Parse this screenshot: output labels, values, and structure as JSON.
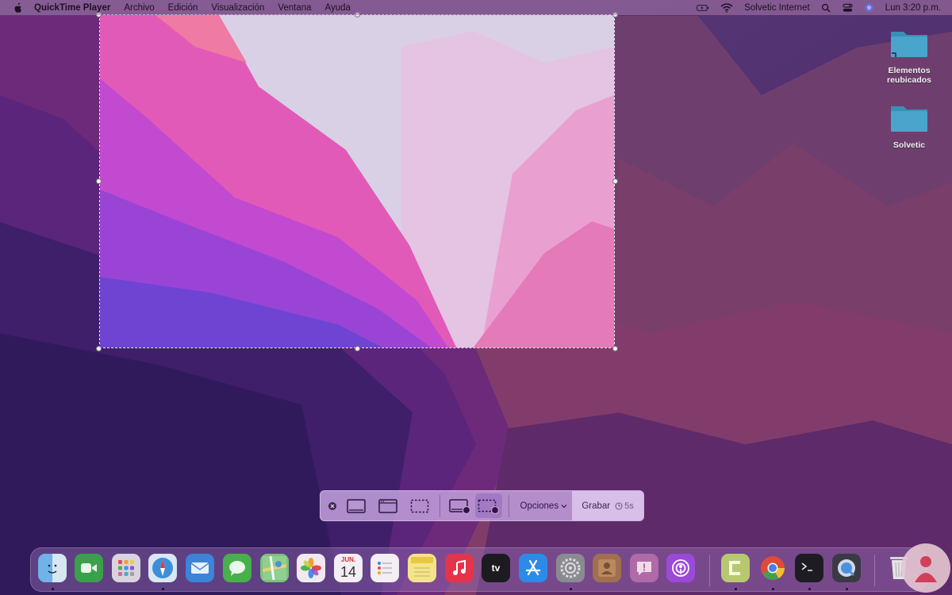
{
  "menubar": {
    "app_name": "QuickTime Player",
    "menus": [
      "Archivo",
      "Edición",
      "Visualización",
      "Ventana",
      "Ayuda"
    ],
    "wifi_name": "Solvetic Internet",
    "clock": "Lun 3:20 p.m."
  },
  "desktop": {
    "items": [
      {
        "label": "Elementos reubicados",
        "icon": "folder-alias-icon"
      },
      {
        "label": "Solvetic",
        "icon": "folder-icon"
      }
    ]
  },
  "screenshot_toolbar": {
    "options_label": "Opciones",
    "record_label": "Grabar",
    "timer_label": "5s",
    "mode_selected": "record-selected-portion"
  },
  "dock": {
    "apps": [
      {
        "name": "finder-icon",
        "running": true
      },
      {
        "name": "facetime-icon",
        "running": false
      },
      {
        "name": "launchpad-icon",
        "running": false
      },
      {
        "name": "safari-icon",
        "running": true
      },
      {
        "name": "mail-icon",
        "running": false
      },
      {
        "name": "messages-icon",
        "running": false
      },
      {
        "name": "maps-icon",
        "running": false
      },
      {
        "name": "photos-icon",
        "running": false
      },
      {
        "name": "calendar-icon",
        "running": false,
        "month": "JUN.",
        "day": "14"
      },
      {
        "name": "reminders-icon",
        "running": false
      },
      {
        "name": "notes-icon",
        "running": false
      },
      {
        "name": "music-icon",
        "running": false
      },
      {
        "name": "apple-tv-icon",
        "running": false,
        "label": "tv"
      },
      {
        "name": "app-store-icon",
        "running": false
      },
      {
        "name": "system-preferences-icon",
        "running": true
      },
      {
        "name": "contacts-icon",
        "running": false
      },
      {
        "name": "feedback-icon",
        "running": false
      },
      {
        "name": "podcasts-icon",
        "running": false
      },
      {
        "name": "camtasia-icon",
        "running": true
      },
      {
        "name": "chrome-icon",
        "running": true
      },
      {
        "name": "terminal-icon",
        "running": true
      },
      {
        "name": "quicktime-icon",
        "running": true
      },
      {
        "name": "trash-icon",
        "running": false
      }
    ]
  }
}
